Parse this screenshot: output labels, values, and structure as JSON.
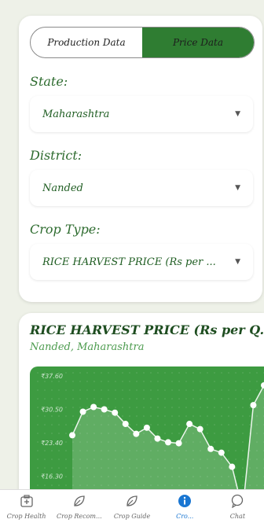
{
  "segments": {
    "production": "Production Data",
    "price": "Price Data"
  },
  "form": {
    "state_label": "State:",
    "state_value": "Maharashtra",
    "district_label": "District:",
    "district_value": "Nanded",
    "crop_label": "Crop Type:",
    "crop_value": "RICE HARVEST PRICE (Rs per ..."
  },
  "chart_card": {
    "title": "RICE HARVEST PRICE (Rs per Q...",
    "subtitle": "Nanded, Maharashtra"
  },
  "chart_data": {
    "type": "line",
    "y_ticks": [
      "₹37.60",
      "₹30.50",
      "₹23.40",
      "₹16.30"
    ],
    "ylim": [
      9.2,
      37.6
    ],
    "values": [
      25.0,
      30.0,
      31.0,
      30.5,
      29.8,
      27.4,
      25.3,
      26.6,
      24.3,
      23.5,
      23.3,
      27.4,
      26.3,
      22.1,
      21.3,
      18.3,
      9.2,
      31.4,
      35.6
    ],
    "grid": true
  },
  "nav": {
    "items": [
      {
        "label": "Crop Health",
        "icon": "health-icon"
      },
      {
        "label": "Crop Recom...",
        "icon": "leaf-icon"
      },
      {
        "label": "Crop Guide",
        "icon": "leaf-icon"
      },
      {
        "label": "Cro...",
        "icon": "info-icon"
      },
      {
        "label": "Chat",
        "icon": "chat-icon"
      }
    ],
    "active_index": 3
  },
  "colors": {
    "accent": "#2f7d32",
    "chart_bg": "#3d9b41",
    "active_nav": "#1976d2"
  }
}
